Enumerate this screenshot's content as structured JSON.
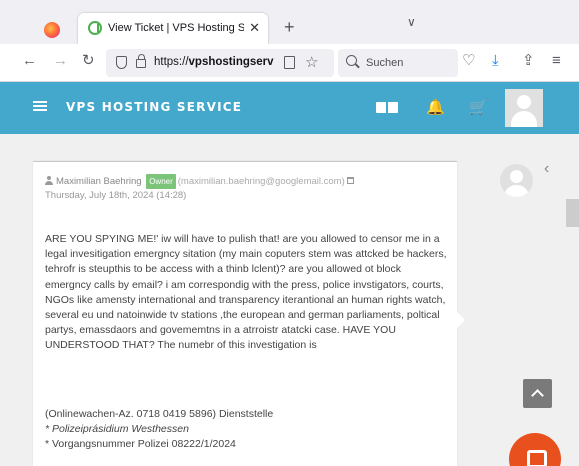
{
  "browser": {
    "tab": {
      "title": "View Ticket | VPS Hosting Servi",
      "close_glyph": "✕"
    },
    "new_tab_glyph": "+",
    "tab_list_glyph": "∨",
    "nav": {
      "back_glyph": "←",
      "forward_glyph": "→",
      "reload_glyph": "↻"
    },
    "url": {
      "scheme": "https://",
      "host": "vpshostingserv"
    },
    "star_glyph": "☆",
    "search_placeholder": "Suchen",
    "toolbar_glyphs": {
      "pocket": "♡",
      "downloads": "⤓",
      "extensions": "⇪",
      "menu": "≡"
    }
  },
  "site": {
    "brand": "VPS HOSTING SERVICE",
    "header_bg": "#44a8cc",
    "bell_glyph": "🔔",
    "cart_glyph": "🛒"
  },
  "ticket": {
    "author": "Maximilian Baehring",
    "badge": "Owner",
    "email": "(maximilian.baehring@googlemail.com)",
    "date": "Thursday, July 18th, 2024 (14:28)",
    "message_paragraphs": [
      "ARE YOU SPYING ME!' iw will have to pulish that! are you allowed to censor me in a legal invesitigation emergncy sitation (my main coputers stem was attcked be hackers, tehrofr is steupthis to be access with a thinb lclent)? are you allowed ot block emergncy calls by email? i am correspondig with the press, police invstigators, courts, NGOs like amensty international and transparency iterantional an human rights watch, several eu und natoinwide tv stations ,the european and german parliaments, poltical partys, emassdaors and govememtns in a atrroistr atatcki case. HAVE YOU UNDERSTOOD THAT? The numebr of this investigation is"
    ],
    "meta_lines": [
      "(Onlinewachen-Az. 0718 0419 5896) Dienststelle",
      "* Polizeiprásidium Westhessen",
      "* Vorgangsnummer Polizei 08222/1/2024"
    ]
  },
  "colors": {
    "accent": "#44a8cc",
    "badge": "#7cc47a",
    "chat_button": "#e8501d",
    "scroll_top_button": "#7a7a7a"
  }
}
